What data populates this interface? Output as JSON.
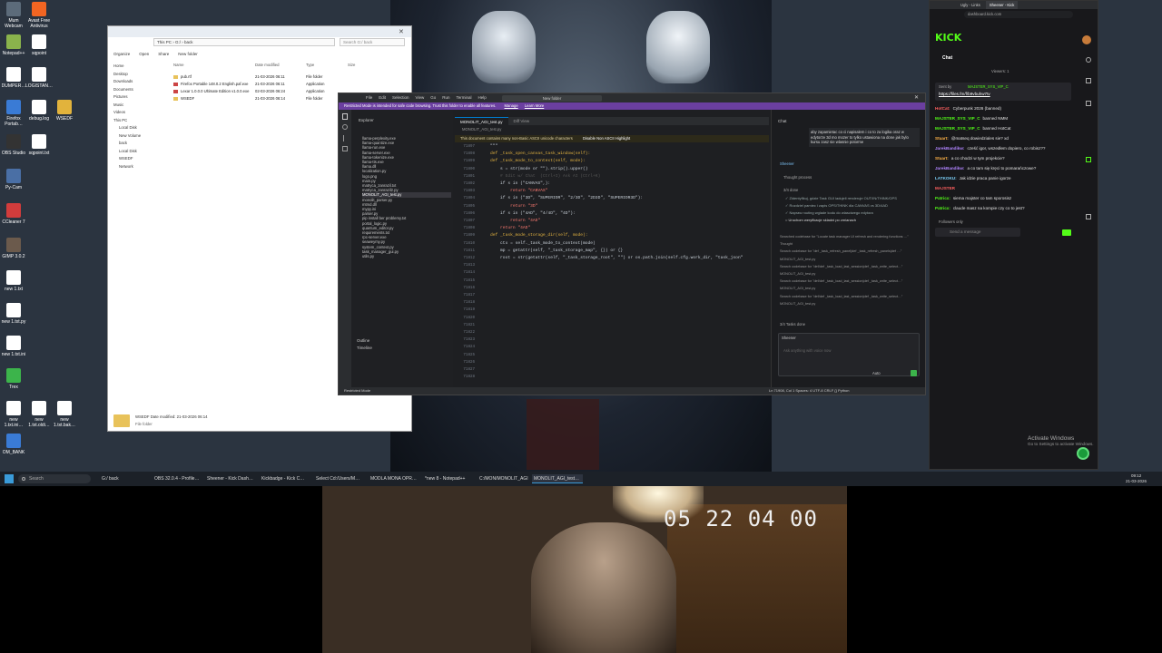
{
  "desktop_icons": [
    {
      "label": "Mum Webcam",
      "color": "#5c6b7a"
    },
    {
      "label": "Avast Free Antivirus",
      "color": "#f26522"
    },
    {
      "label": "Notepad++",
      "color": "#8ab34c"
    },
    {
      "label": "sqpoint",
      "color": "#ffffff"
    },
    {
      "label": "DUMPER…",
      "color": "#ffffff"
    },
    {
      "label": "LOGISTAN…",
      "color": "#ffffff"
    },
    {
      "label": "Firefox Portab…",
      "color": "#3a7bd5"
    },
    {
      "label": "debug.log",
      "color": "#ffffff"
    },
    {
      "label": "WSEDF",
      "color": "#e2b33c"
    },
    {
      "label": "OBS Studio",
      "color": "#333333"
    },
    {
      "label": "sqpoint.txt",
      "color": "#ffffff"
    },
    {
      "label": "Py-Cam",
      "color": "#4a6fa5"
    },
    {
      "label": "CCleaner 7",
      "color": "#d23c3c"
    },
    {
      "label": "GIMP 3.0.2",
      "color": "#6b5a4c"
    },
    {
      "label": "new 1.txt",
      "color": "#ffffff"
    },
    {
      "label": "new 1.txt.py",
      "color": "#ffffff"
    },
    {
      "label": "new 1.txt.ini",
      "color": "#ffffff"
    },
    {
      "label": "Trex",
      "color": "#3cb44b"
    },
    {
      "label": "new 1.txt.ini…",
      "color": "#ffffff"
    },
    {
      "label": "new 1.txt.oldi…",
      "color": "#ffffff"
    },
    {
      "label": "new 1.txt.bak…",
      "color": "#ffffff"
    },
    {
      "label": "OM_BANK",
      "color": "#3a7bd5"
    }
  ],
  "explorer": {
    "address": "This PC › G:/ › back",
    "search_placeholder": "Search G:/ back",
    "toolbar": [
      "Organize",
      "Open",
      "Share",
      "New folder"
    ],
    "columns": [
      "Name",
      "Date modified",
      "Type",
      "Size"
    ],
    "nav_items": [
      "Home",
      "Desktop",
      "Downloads",
      "Documents",
      "Pictures",
      "Music",
      "Videos",
      "This PC",
      "Local Disk",
      "New Volume",
      "back",
      "Local Disk",
      "WSEDF",
      "Network"
    ],
    "files": [
      {
        "name": "pub.rtf",
        "date": "21-03-2026 06:11",
        "type": "File folder"
      },
      {
        "name": "Firefox Portable 148.0.2 English.paf.exe",
        "date": "21-03-2026 06:11",
        "type": "Application"
      },
      {
        "name": "Lexar 1.0.0.0 Ultimate Edition v1.0.0.exe",
        "date": "02-03-2026 06:24",
        "type": "Application"
      },
      {
        "name": "WSEDF",
        "date": "21-03-2026 06:14",
        "type": "File folder"
      }
    ],
    "status_folder": "WSEDF  Date modified: 21-03-2026 06:14",
    "status_type": "File folder"
  },
  "vscode": {
    "menu": [
      "File",
      "Edit",
      "Selection",
      "View",
      "Go",
      "Run",
      "Terminal",
      "Help"
    ],
    "command_center": "New folder",
    "restricted_banner": "Restricted Mode is intended for safe code browsing. Trust this folder to enable all features.",
    "banner_links": [
      "Manage",
      "Learn More"
    ],
    "explorer_title": "Explorer",
    "tabs": [
      "MONOLIT_AGI_test.py",
      "Diff View"
    ],
    "breadcrumb": "MONOLIT_AGI_test.py",
    "unicode_warning": "This document contains many non-Basic ASCII unicode characters",
    "unicode_action": "Disable Non ASCII Highlight",
    "files": [
      "llama-perplexity.exe",
      "llama-quantize.exe",
      "llama-run.exe",
      "llama-server.exe",
      "llama-tokenize.exe",
      "llama-tts.exe",
      "llama.dll",
      "localization.py",
      "logo.png",
      "main.py",
      "matryca_zanrazil.txt",
      "matryca_zanrazil2.py",
      "MONOLIT_AGI_test.py",
      "monolit_parser.py",
      "mtmd.dll",
      "mypy.ini",
      "parser.py",
      "pip install ber problemy.txt",
      "portal_logic.py",
      "quantum_editor.py",
      "requirements.txt",
      "rpc-server.exe",
      "seaweymy.py",
      "system_context.py",
      "task_manager_gui.py",
      "utils.py"
    ],
    "outline": "Outline",
    "timeline": "Timeline",
    "line_numbers": [
      "71897",
      "71898",
      "71899",
      "71800",
      "71801",
      "71802",
      "71803",
      "71804",
      "71805",
      "71806",
      "71807",
      "71808",
      "71809",
      "71810",
      "71811",
      "71812",
      "71813",
      "71814",
      "71815",
      "71816",
      "71817",
      "71818",
      "71819",
      "71820",
      "71821",
      "71822",
      "71823",
      "71824",
      "71825",
      "71826",
      "71827",
      "71828",
      "71829",
      "71830",
      "71831"
    ],
    "code": [
      "    \"\"\"",
      "",
      "    def _task_open_canvas_task_window(self):",
      "",
      "",
      "",
      "    def _task_mode_to_context(self, mode):",
      "",
      "        s = str(mode or \"\").strip().upper()",
      "        # Edit w/ Chat  (Ctrl+I) Ask AI (Ctrl+K)",
      "        if s in (\"CANVAS\",):",
      "",
      "            return \"CANVAS\"",
      "",
      "        if s in (\"3D\", \"SUPERIOR\", \"2/3D\", \"2D3D\", \"SUPERIOR3D\"):",
      "",
      "            return \"3D\"",
      "",
      "        if s in (\"4AD\", \"4/4D\", \"4D\"):",
      "",
      "            return \"4AD\"",
      "",
      "        return \"4AD\"",
      "",
      "",
      "",
      "    def _task_mode_storage_dir(self, mode):",
      "",
      "        ctx = self._task_mode_to_context(mode)",
      "",
      "        mp = getattr(self, \"_task_storage_map\", {}) or {}",
      "",
      "        root = str(getattr(self, \"_task_storage_root\", \"\") or os.path.join(self.cfg.work_dir, \"task_json\"",
      "",
      ""
    ],
    "chat_title": "Chat",
    "chat_user_msg": "aby zapamietac co ci napisalem i co to za logika oraz w edytorze 3d mo mozer to tylko ustawiona na done jak bylo kursu zasz sie wlasnie potorme",
    "thought_label": "Thought process",
    "steps_done": "3/4 done",
    "todo_items": [
      "Zidentyfikuj, gdzie Task GUI ladujeli renderuje OUT/IN/THINK/OPS",
      "Rozdziel pamiec i zapis OPS/THINK dla CANVAS vs 3D/4AD",
      "Napraw routing wglade kodu do wlasciwego edytora",
      "Uruchom weryfikacje skladni po zmianach"
    ],
    "search_lines": [
      "Searched codebase for \"Locate task manager UI refresh and rendering functions …\"",
      "Thought",
      "Search codebase for \"def _task_refresh_panel|def _task_refresh_panels|def …\"",
      "MONOLIT_AGI_test.py",
      "Search codebase for \"def/def _task_load_last_session|def _task_write_select…\"",
      "MONOLIT_AGI_test.py",
      "Search codebase for \"def/def _task_load_last_session|def _task_write_select…\"",
      "MONOLIT_AGI_test.py",
      "Search codebase for \"def/def _task_load_last_session|def _task_write_select…\"",
      "MONOLIT_AGI_test.py"
    ],
    "tasks_done": "3/4 Tasks done",
    "agent_name": "Sheener",
    "input_placeholder": "Ask anything with voice now",
    "mode": "Auto",
    "status_left": "Restricted Mode",
    "status_right": "Ln 71908, Col 1   Spaces: 4   UTF-8   CRLF   {} Python"
  },
  "browser": {
    "tabs": [
      "Ugly - Links",
      "Sheener - Kick"
    ],
    "url": "dashboard.kick.com",
    "logo": "KICK",
    "chat_title": "Chat",
    "viewers": "Viewers: 1",
    "pinned_by": "Sent by",
    "pinned_user": "MAJSTER_SYS_VIP_C",
    "pinned_link": "https://files.fm/f/b9vbuhw7tv",
    "messages": [
      {
        "user": "HotCat:",
        "text": "Cyberpunk 2026 (banned)",
        "color": "#ff5f5f"
      },
      {
        "user": "MAJSTER_SYS_VIP_C",
        "text": "banned NMM",
        "color": "#53fc18"
      },
      {
        "user": "MAJSTER_SYS_VIP_C",
        "text": "banned HotCat",
        "color": "#53fc18"
      },
      {
        "user": "Stuart:",
        "text": "@matseq dowiedziales sie? xd",
        "color": "#ffb347"
      },
      {
        "user": "JarekBandikw:",
        "text": "cześć igor, wszedłem dopiero, co robisz??",
        "color": "#b084ff"
      },
      {
        "user": "Stuart:",
        "text": "a co chodzi w tym projekcie?",
        "color": "#ffb347"
      },
      {
        "user": "JarekBandikw:",
        "text": "a co tam się kręci to pomarańczowe?",
        "color": "#b084ff"
      },
      {
        "user": "LATKOKU:",
        "text": "Jak idzie praca panie igorze",
        "color": "#7dd3fc"
      },
      {
        "user": "MAJSTER",
        "text": "",
        "color": "#ff5f5f"
      },
      {
        "user": "Patricx:",
        "text": "siema majster co tam sporosisz",
        "color": "#53fc18"
      },
      {
        "user": "Patricx:",
        "text": "claude masz na kompie czy co to jest?",
        "color": "#53fc18"
      }
    ],
    "followers_only": "Followers only",
    "send_placeholder": "Send a message"
  },
  "activation": {
    "title": "Activate Windows",
    "subtitle": "Go to Settings to activate Windows."
  },
  "taskbar": {
    "search": "Search",
    "items": [
      "G:/ back",
      "OBS 32.0.4 - Profile…",
      "Sheener - Kick Dash…",
      "Kickbadge - Kick C…",
      "Select Cd:/Users/M…",
      "MODLA MONA OPR…",
      "*new 8 - Notepad++",
      "C:/MON/MONOLIT_AGI…",
      "MONOLIT_AGI_test…"
    ],
    "clock_time": "09:12",
    "clock_date": "21-03-2026"
  },
  "webcam": {
    "timecode": "05 22 04 00"
  },
  "colors": {
    "kick_green": "#53fc18",
    "vscode_blue": "#007acc",
    "restricted_purple": "#6b3fa0"
  }
}
